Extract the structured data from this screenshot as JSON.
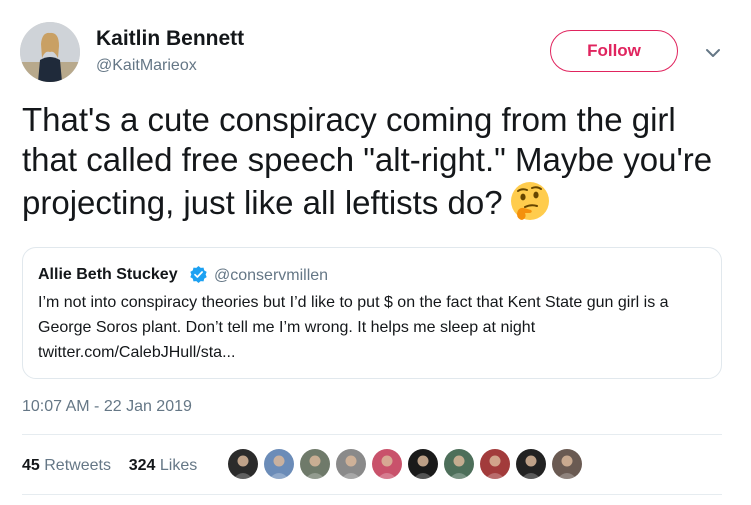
{
  "author": {
    "name": "Kaitlin Bennett",
    "handle": "@KaitMarieox",
    "follow_label": "Follow"
  },
  "tweet": {
    "text": "That's a cute conspiracy coming from the girl that called free speech \"alt-right.\" Maybe you're projecting, just like all leftists do?",
    "emoji": "thinking-face-icon"
  },
  "quoted_tweet": {
    "name": "Allie Beth Stuckey",
    "verified": true,
    "handle": "@conservmillen",
    "text": "I’m not into conspiracy theories but I’d like to put $ on the fact that Kent State gun girl is a George Soros plant. Don’t tell me I’m wrong. It helps me sleep at night",
    "link": "twitter.com/CalebJHull/sta..."
  },
  "timestamp": "10:07 AM - 22 Jan 2019",
  "stats": {
    "retweets_count": "45",
    "retweets_label": "Retweets",
    "likes_count": "324",
    "likes_label": "Likes"
  },
  "likers": [
    {
      "color": "#2b2b2b"
    },
    {
      "color": "#6b8cb8"
    },
    {
      "color": "#6f7a6a"
    },
    {
      "color": "#8a8a8a"
    },
    {
      "color": "#c9526b"
    },
    {
      "color": "#1a1a1a"
    },
    {
      "color": "#4d6f5a"
    },
    {
      "color": "#a23b3b"
    },
    {
      "color": "#222222"
    },
    {
      "color": "#6a5a52"
    }
  ],
  "colors": {
    "follow": "#e0245e",
    "secondary_text": "#657786",
    "verified": "#1da1f2"
  }
}
